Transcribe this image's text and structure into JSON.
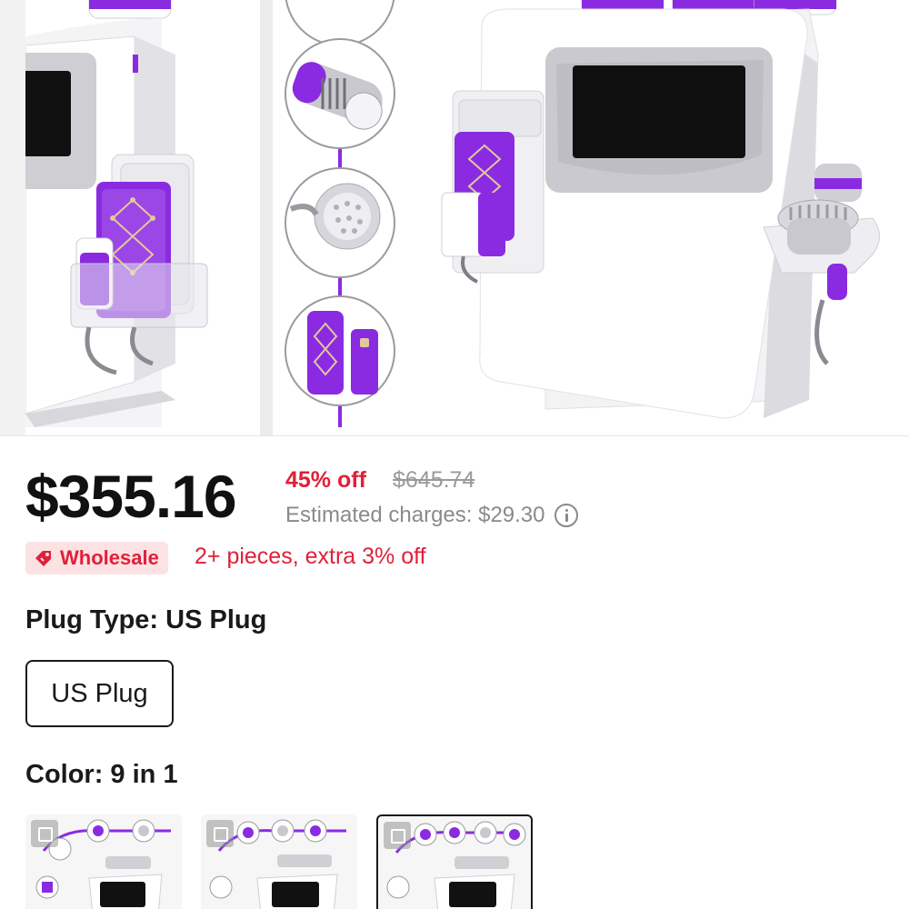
{
  "product": {
    "price": "$355.16",
    "discount": "45% off",
    "original_price": "$645.74",
    "estimated_charges": "Estimated charges: $29.30"
  },
  "promo": {
    "badge_label": "Wholesale",
    "text": "2+ pieces, extra 3% off"
  },
  "options": {
    "plug_type_label": "Plug Type: US Plug",
    "plug_choices": [
      "US Plug"
    ],
    "color_label": "Color: 9 in 1",
    "color_thumbnail_count": 3,
    "selected_color_index": 2
  },
  "colors": {
    "accent_red": "#e0203a",
    "badge_bg": "#fde2e3",
    "product_purple": "#8a2be2"
  }
}
